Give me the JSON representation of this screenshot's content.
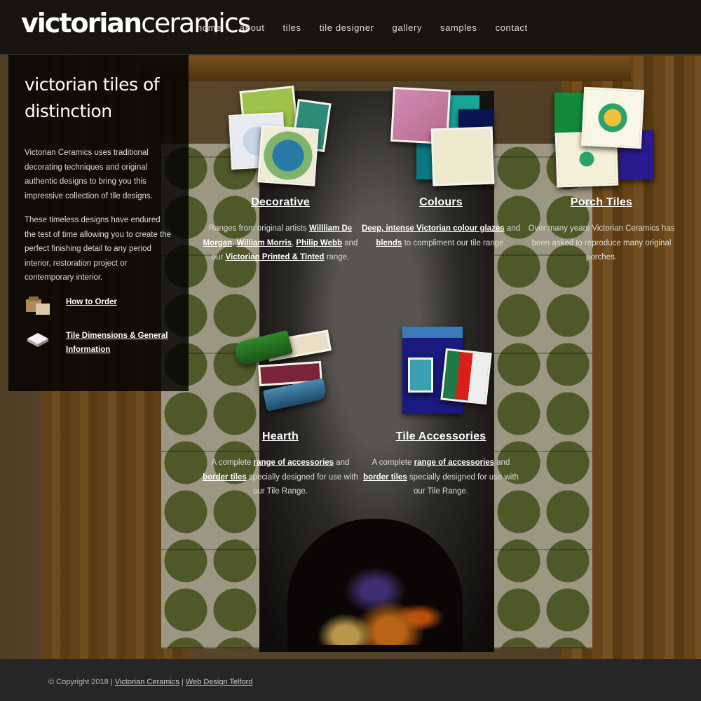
{
  "header": {
    "logo_bold": "victorian",
    "logo_light": "ceramics",
    "nav": [
      "home",
      "about",
      "tiles",
      "tile designer",
      "gallery",
      "samples",
      "contact"
    ]
  },
  "intro": {
    "heading": "victorian tiles of distinction",
    "para1": "Victorian Ceramics uses traditional decorating techniques and original authentic designs to bring you this impressive collection of tile designs.",
    "para2": "These timeless designs have endured the test of time allowing you to create the perfect finishing detail to any period interior, restoration project or contemporary interior.",
    "link_order": "How to Order",
    "link_dimensions": "Tile Dimensions & General Information"
  },
  "cards": {
    "decorative": {
      "title": "Decorative",
      "t1": "Ranges from original artists ",
      "l1": "Willliam De Morgan",
      "t2": ", ",
      "l2": "William Morris",
      "t3": ", ",
      "l3": "Philip Webb",
      "t4": " and our ",
      "l4": "Victorian Printed & Tinted",
      "t5": " range."
    },
    "colours": {
      "title": "Colours",
      "l1": "Deep, intense Victorian colour glazes",
      "t1": " and ",
      "l2": "blends",
      "t2": " to compliment our tile range."
    },
    "porch": {
      "title": "Porch Tiles",
      "text": "Over many years Victorian Ceramics has been asked to reproduce many original porches."
    },
    "hearth": {
      "title": "Hearth",
      "t1": "A complete ",
      "l1": "range of accessories",
      "t2": " and ",
      "l2": "border tiles",
      "t3": " specially designed for use with our Tile Range."
    },
    "accessories": {
      "title": "Tile Accessories",
      "t1": "A complete ",
      "l1": "range of accessories",
      "t2": " and ",
      "l2": "border tiles",
      "t3": " specially designed for use with our Tile Range."
    }
  },
  "footer": {
    "copyright": "© Copyright 2018 | ",
    "link1": "Victorian Ceramics",
    "sep": " | ",
    "link2": "Web Design Telford"
  },
  "colors": {
    "header_bg": "#121110",
    "footer_bg": "#262626",
    "panel_bg": "#000000"
  }
}
